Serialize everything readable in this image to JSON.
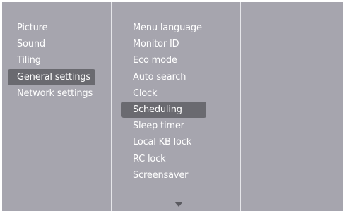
{
  "colors": {
    "background": "#a6a5ae",
    "selected_bg": "#6a6a70",
    "text": "#ffffff",
    "divider": "#e6e6ea",
    "arrow": "#5a5a60"
  },
  "main_menu": {
    "items": [
      {
        "label": "Picture",
        "selected": false
      },
      {
        "label": "Sound",
        "selected": false
      },
      {
        "label": "Tiling",
        "selected": false
      },
      {
        "label": "General settings",
        "selected": true
      },
      {
        "label": "Network settings",
        "selected": false
      }
    ]
  },
  "sub_menu": {
    "items": [
      {
        "label": "Menu language",
        "selected": false
      },
      {
        "label": "Monitor ID",
        "selected": false
      },
      {
        "label": "Eco mode",
        "selected": false
      },
      {
        "label": "Auto search",
        "selected": false
      },
      {
        "label": "Clock",
        "selected": false
      },
      {
        "label": "Scheduling",
        "selected": true
      },
      {
        "label": "Sleep timer",
        "selected": false
      },
      {
        "label": "Local KB lock",
        "selected": false
      },
      {
        "label": "RC lock",
        "selected": false
      },
      {
        "label": "Screensaver",
        "selected": false
      }
    ],
    "more_icon": "triangle-down"
  }
}
